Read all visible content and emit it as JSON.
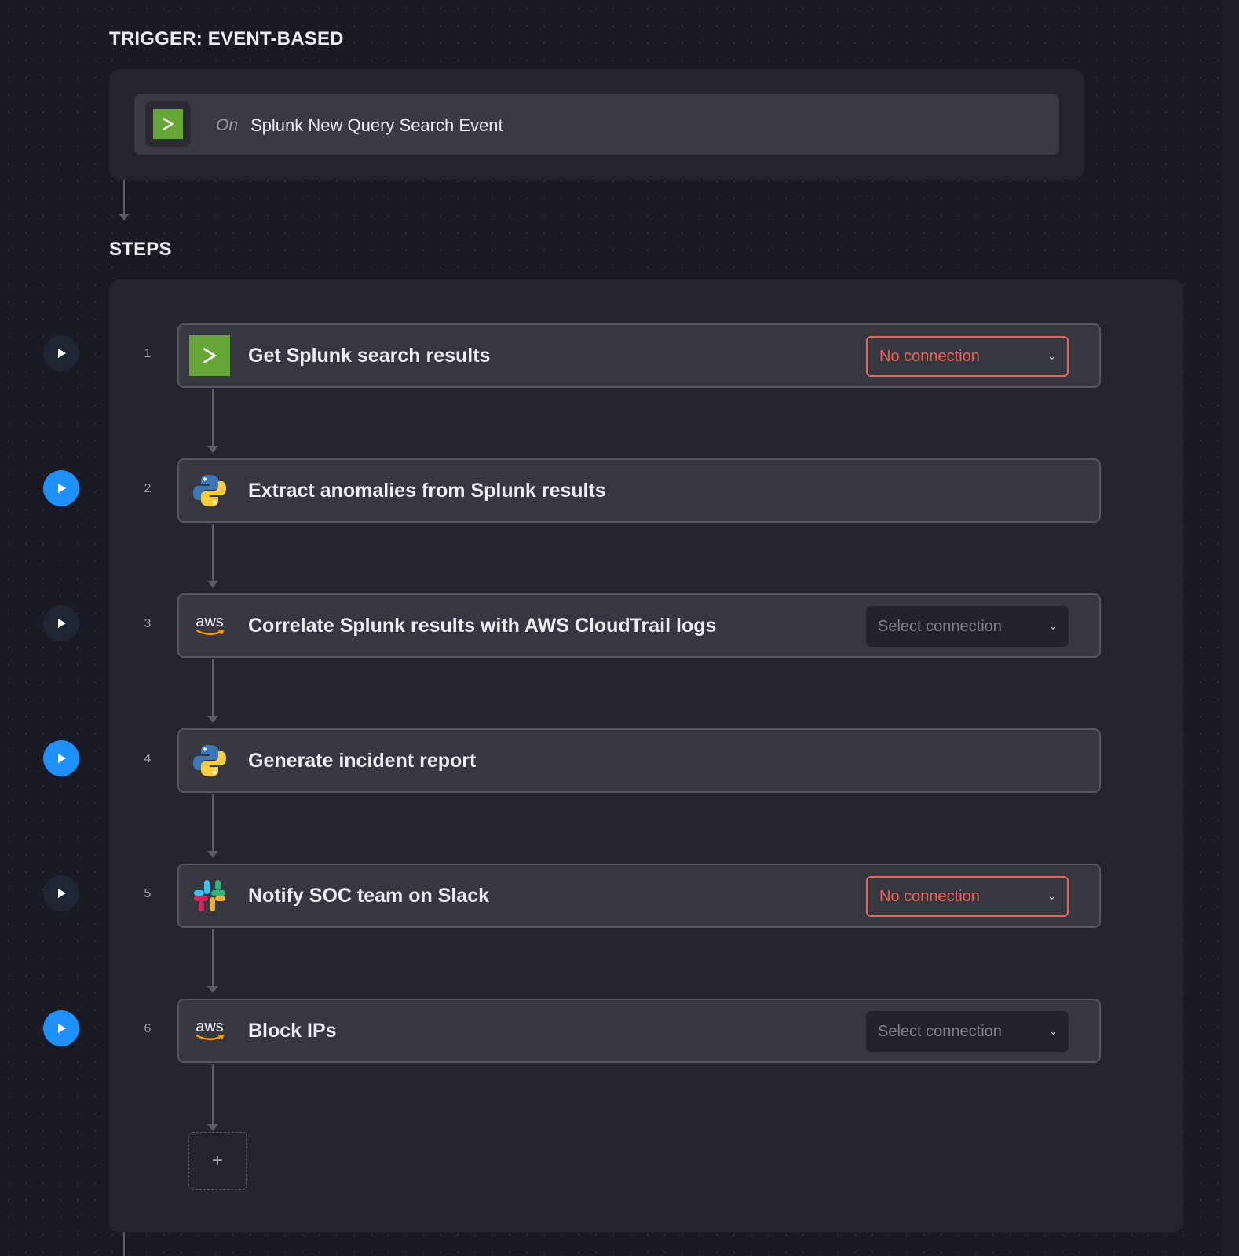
{
  "trigger": {
    "title": "TRIGGER: EVENT-BASED",
    "on_label": "On",
    "event_label": "Splunk New Query Search Event",
    "icon": "splunk-icon"
  },
  "steps_title": "STEPS",
  "steps": [
    {
      "number": "1",
      "title": "Get Splunk search results",
      "icon": "splunk-icon",
      "run_button": "dark",
      "connection": "No connection",
      "connection_state": "no-connection"
    },
    {
      "number": "2",
      "title": "Extract anomalies from Splunk results",
      "icon": "python-icon",
      "run_button": "blue"
    },
    {
      "number": "3",
      "title": "Correlate Splunk results with AWS CloudTrail logs",
      "icon": "aws-icon",
      "run_button": "dark",
      "connection": "Select connection",
      "connection_state": "select"
    },
    {
      "number": "4",
      "title": "Generate incident report",
      "icon": "python-icon",
      "run_button": "blue"
    },
    {
      "number": "5",
      "title": "Notify SOC team on Slack",
      "icon": "slack-icon",
      "run_button": "dark",
      "connection": "No connection",
      "connection_state": "no-connection"
    },
    {
      "number": "6",
      "title": "Block IPs",
      "icon": "aws-icon",
      "run_button": "blue",
      "connection": "Select connection",
      "connection_state": "select"
    }
  ],
  "icons": {
    "aws_text": "aws"
  },
  "add_step": {
    "label": "+"
  },
  "colors": {
    "accent_blue": "#1e90ff",
    "error": "#f2604e",
    "splunk_green": "#65a637",
    "background": "#1a1a24"
  }
}
